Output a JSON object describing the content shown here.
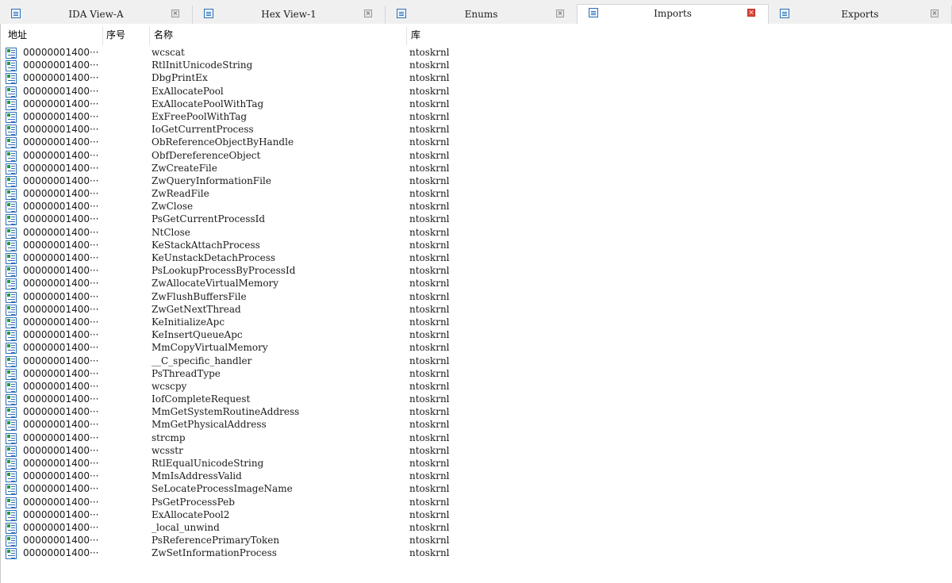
{
  "tabs": [
    {
      "label": "IDA View-A",
      "icon": "ida-view-icon",
      "active": false
    },
    {
      "label": "Hex View-1",
      "icon": "hex-view-icon",
      "active": false
    },
    {
      "label": "Enums",
      "icon": "enums-icon",
      "active": false
    },
    {
      "label": "Imports",
      "icon": "imports-icon",
      "active": true
    },
    {
      "label": "Exports",
      "icon": "exports-icon",
      "active": false
    }
  ],
  "tab_close_glyph": "×",
  "columns": {
    "address": "地址",
    "ordinal": "序号",
    "name": "名称",
    "library": "库"
  },
  "colors": {
    "active_close": "#e0463a",
    "icon_blue": "#2f6fb6",
    "icon_green": "#1f9c3a"
  },
  "imports": [
    {
      "address": "00000001400···",
      "ordinal": "",
      "name": "wcscat",
      "library": "ntoskrnl"
    },
    {
      "address": "00000001400···",
      "ordinal": "",
      "name": "RtlInitUnicodeString",
      "library": "ntoskrnl"
    },
    {
      "address": "00000001400···",
      "ordinal": "",
      "name": "DbgPrintEx",
      "library": "ntoskrnl"
    },
    {
      "address": "00000001400···",
      "ordinal": "",
      "name": "ExAllocatePool",
      "library": "ntoskrnl"
    },
    {
      "address": "00000001400···",
      "ordinal": "",
      "name": "ExAllocatePoolWithTag",
      "library": "ntoskrnl"
    },
    {
      "address": "00000001400···",
      "ordinal": "",
      "name": "ExFreePoolWithTag",
      "library": "ntoskrnl"
    },
    {
      "address": "00000001400···",
      "ordinal": "",
      "name": "IoGetCurrentProcess",
      "library": "ntoskrnl"
    },
    {
      "address": "00000001400···",
      "ordinal": "",
      "name": "ObReferenceObjectByHandle",
      "library": "ntoskrnl"
    },
    {
      "address": "00000001400···",
      "ordinal": "",
      "name": "ObfDereferenceObject",
      "library": "ntoskrnl"
    },
    {
      "address": "00000001400···",
      "ordinal": "",
      "name": "ZwCreateFile",
      "library": "ntoskrnl"
    },
    {
      "address": "00000001400···",
      "ordinal": "",
      "name": "ZwQueryInformationFile",
      "library": "ntoskrnl"
    },
    {
      "address": "00000001400···",
      "ordinal": "",
      "name": "ZwReadFile",
      "library": "ntoskrnl"
    },
    {
      "address": "00000001400···",
      "ordinal": "",
      "name": "ZwClose",
      "library": "ntoskrnl"
    },
    {
      "address": "00000001400···",
      "ordinal": "",
      "name": "PsGetCurrentProcessId",
      "library": "ntoskrnl"
    },
    {
      "address": "00000001400···",
      "ordinal": "",
      "name": "NtClose",
      "library": "ntoskrnl"
    },
    {
      "address": "00000001400···",
      "ordinal": "",
      "name": "KeStackAttachProcess",
      "library": "ntoskrnl"
    },
    {
      "address": "00000001400···",
      "ordinal": "",
      "name": "KeUnstackDetachProcess",
      "library": "ntoskrnl"
    },
    {
      "address": "00000001400···",
      "ordinal": "",
      "name": "PsLookupProcessByProcessId",
      "library": "ntoskrnl"
    },
    {
      "address": "00000001400···",
      "ordinal": "",
      "name": "ZwAllocateVirtualMemory",
      "library": "ntoskrnl"
    },
    {
      "address": "00000001400···",
      "ordinal": "",
      "name": "ZwFlushBuffersFile",
      "library": "ntoskrnl"
    },
    {
      "address": "00000001400···",
      "ordinal": "",
      "name": "ZwGetNextThread",
      "library": "ntoskrnl"
    },
    {
      "address": "00000001400···",
      "ordinal": "",
      "name": "KeInitializeApc",
      "library": "ntoskrnl"
    },
    {
      "address": "00000001400···",
      "ordinal": "",
      "name": "KeInsertQueueApc",
      "library": "ntoskrnl"
    },
    {
      "address": "00000001400···",
      "ordinal": "",
      "name": "MmCopyVirtualMemory",
      "library": "ntoskrnl"
    },
    {
      "address": "00000001400···",
      "ordinal": "",
      "name": "__C_specific_handler",
      "library": "ntoskrnl"
    },
    {
      "address": "00000001400···",
      "ordinal": "",
      "name": "PsThreadType",
      "library": "ntoskrnl"
    },
    {
      "address": "00000001400···",
      "ordinal": "",
      "name": "wcscpy",
      "library": "ntoskrnl"
    },
    {
      "address": "00000001400···",
      "ordinal": "",
      "name": "IofCompleteRequest",
      "library": "ntoskrnl"
    },
    {
      "address": "00000001400···",
      "ordinal": "",
      "name": "MmGetSystemRoutineAddress",
      "library": "ntoskrnl"
    },
    {
      "address": "00000001400···",
      "ordinal": "",
      "name": "MmGetPhysicalAddress",
      "library": "ntoskrnl"
    },
    {
      "address": "00000001400···",
      "ordinal": "",
      "name": "strcmp",
      "library": "ntoskrnl"
    },
    {
      "address": "00000001400···",
      "ordinal": "",
      "name": "wcsstr",
      "library": "ntoskrnl"
    },
    {
      "address": "00000001400···",
      "ordinal": "",
      "name": "RtlEqualUnicodeString",
      "library": "ntoskrnl"
    },
    {
      "address": "00000001400···",
      "ordinal": "",
      "name": "MmIsAddressValid",
      "library": "ntoskrnl"
    },
    {
      "address": "00000001400···",
      "ordinal": "",
      "name": "SeLocateProcessImageName",
      "library": "ntoskrnl"
    },
    {
      "address": "00000001400···",
      "ordinal": "",
      "name": "PsGetProcessPeb",
      "library": "ntoskrnl"
    },
    {
      "address": "00000001400···",
      "ordinal": "",
      "name": "ExAllocatePool2",
      "library": "ntoskrnl"
    },
    {
      "address": "00000001400···",
      "ordinal": "",
      "name": "_local_unwind",
      "library": "ntoskrnl"
    },
    {
      "address": "00000001400···",
      "ordinal": "",
      "name": "PsReferencePrimaryToken",
      "library": "ntoskrnl"
    },
    {
      "address": "00000001400···",
      "ordinal": "",
      "name": "ZwSetInformationProcess",
      "library": "ntoskrnl"
    }
  ]
}
